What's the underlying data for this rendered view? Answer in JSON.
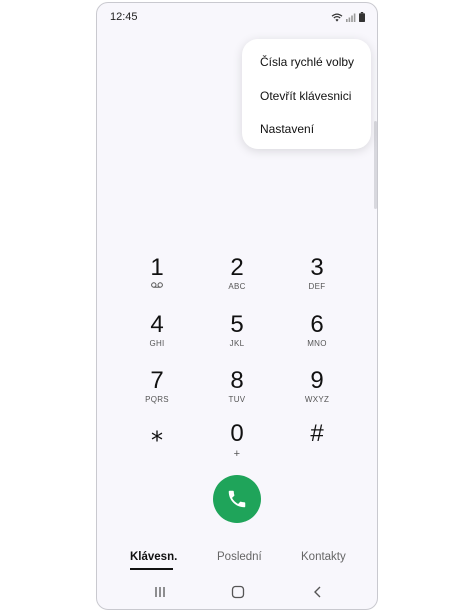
{
  "status": {
    "time": "12:45"
  },
  "menu": {
    "items": [
      {
        "label": "Čísla rychlé volby"
      },
      {
        "label": "Otevřít klávesnici"
      },
      {
        "label": "Nastavení"
      }
    ]
  },
  "keypad": {
    "keys": [
      {
        "digit": "1",
        "letters": ""
      },
      {
        "digit": "2",
        "letters": "ABC"
      },
      {
        "digit": "3",
        "letters": "DEF"
      },
      {
        "digit": "4",
        "letters": "GHI"
      },
      {
        "digit": "5",
        "letters": "JKL"
      },
      {
        "digit": "6",
        "letters": "MNO"
      },
      {
        "digit": "7",
        "letters": "PQRS"
      },
      {
        "digit": "8",
        "letters": "TUV"
      },
      {
        "digit": "9",
        "letters": "WXYZ"
      },
      {
        "digit": "⁎",
        "letters": ""
      },
      {
        "digit": "0",
        "letters": "+"
      },
      {
        "digit": "#",
        "letters": ""
      }
    ]
  },
  "call": {
    "icon": "phone-icon",
    "color": "#1fa45a"
  },
  "tabs": [
    {
      "label": "Klávesn.",
      "active": true
    },
    {
      "label": "Poslední",
      "active": false
    },
    {
      "label": "Kontakty",
      "active": false
    }
  ],
  "nav": {
    "icons": [
      "recents-icon",
      "home-icon",
      "back-icon"
    ]
  }
}
